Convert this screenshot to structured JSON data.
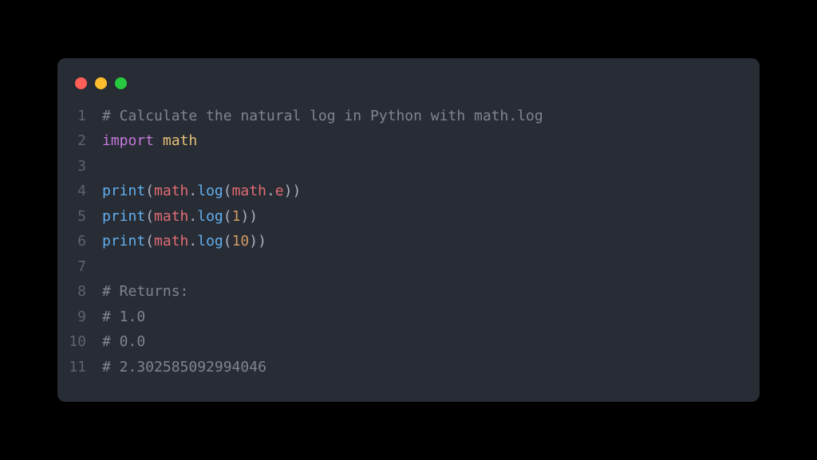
{
  "window": {
    "dots": [
      "red",
      "yellow",
      "green"
    ]
  },
  "code": {
    "lines": [
      {
        "n": "1",
        "tokens": [
          {
            "cls": "c-comment",
            "t": "# Calculate the natural log in Python with math.log"
          }
        ]
      },
      {
        "n": "2",
        "tokens": [
          {
            "cls": "c-keyword",
            "t": "import"
          },
          {
            "cls": "c-plain",
            "t": " "
          },
          {
            "cls": "c-module",
            "t": "math"
          }
        ]
      },
      {
        "n": "3",
        "tokens": []
      },
      {
        "n": "4",
        "tokens": [
          {
            "cls": "c-func",
            "t": "print"
          },
          {
            "cls": "c-punc",
            "t": "("
          },
          {
            "cls": "c-obj",
            "t": "math"
          },
          {
            "cls": "c-punc",
            "t": "."
          },
          {
            "cls": "c-func",
            "t": "log"
          },
          {
            "cls": "c-punc",
            "t": "("
          },
          {
            "cls": "c-obj",
            "t": "math"
          },
          {
            "cls": "c-punc",
            "t": "."
          },
          {
            "cls": "c-prop",
            "t": "e"
          },
          {
            "cls": "c-punc",
            "t": "))"
          }
        ]
      },
      {
        "n": "5",
        "tokens": [
          {
            "cls": "c-func",
            "t": "print"
          },
          {
            "cls": "c-punc",
            "t": "("
          },
          {
            "cls": "c-obj",
            "t": "math"
          },
          {
            "cls": "c-punc",
            "t": "."
          },
          {
            "cls": "c-func",
            "t": "log"
          },
          {
            "cls": "c-punc",
            "t": "("
          },
          {
            "cls": "c-num",
            "t": "1"
          },
          {
            "cls": "c-punc",
            "t": "))"
          }
        ]
      },
      {
        "n": "6",
        "tokens": [
          {
            "cls": "c-func",
            "t": "print"
          },
          {
            "cls": "c-punc",
            "t": "("
          },
          {
            "cls": "c-obj",
            "t": "math"
          },
          {
            "cls": "c-punc",
            "t": "."
          },
          {
            "cls": "c-func",
            "t": "log"
          },
          {
            "cls": "c-punc",
            "t": "("
          },
          {
            "cls": "c-num",
            "t": "10"
          },
          {
            "cls": "c-punc",
            "t": "))"
          }
        ]
      },
      {
        "n": "7",
        "tokens": []
      },
      {
        "n": "8",
        "tokens": [
          {
            "cls": "c-comment",
            "t": "# Returns:"
          }
        ]
      },
      {
        "n": "9",
        "tokens": [
          {
            "cls": "c-comment",
            "t": "# 1.0"
          }
        ]
      },
      {
        "n": "10",
        "tokens": [
          {
            "cls": "c-comment",
            "t": "# 0.0"
          }
        ]
      },
      {
        "n": "11",
        "tokens": [
          {
            "cls": "c-comment",
            "t": "# 2.302585092994046"
          }
        ]
      }
    ]
  }
}
